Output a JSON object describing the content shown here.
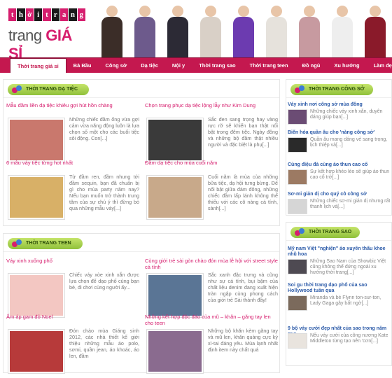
{
  "logo": {
    "top_letters": [
      "t",
      "h",
      "ờ",
      "i",
      "t",
      "r",
      "a",
      "n",
      "g"
    ],
    "bottom_plain": "trang ",
    "bottom_bold": "GIÁ SỈ"
  },
  "banner_colors": [
    "#3b2d28",
    "#6d5a8c",
    "#2c2a35",
    "#d9d0c7",
    "#6c3bb0",
    "#e6e2dc",
    "#c79aa0",
    "#eeeeee",
    "#8a1a2a"
  ],
  "nav": [
    "Thời trang giá sỉ",
    "Bà Bầu",
    "Công sở",
    "Dạ tiệc",
    "Nội y",
    "Thời trang sao",
    "Thời trang teen",
    "Đồ ngủ",
    "Xu hướng",
    "Làm đẹp"
  ],
  "sections": [
    {
      "heading": "THỜI TRANG DẠ TIỆC",
      "posts": [
        {
          "title": "Mẫu đầm liền dạ tiệc khiêu gợi hút hồn chàng",
          "excerpt": "Những chiếc đầm ống vừa gợi cảm vừa năng động luôn là lựa chọn số một cho các buổi tiệc sôi động. Con[...]",
          "thumb": "#c9786d"
        },
        {
          "title": "Chọn trang phục dạ tiệc lộng lẫy như Kim Dung",
          "excerpt": "Sắc đen sang trọng hay vàng rực rỡ sẽ khiến bạn thật nổi bật trong đêm tiệc. Ngày đông và những bộ đầm thật nhiều người và đặc biệt là phụ[...]",
          "thumb": "#3a3a3a"
        },
        {
          "title": "6 mẫu váy tiệc từng hot nhất",
          "excerpt": "Từ đầm ren, đầm nhung tới đầm sequin, bạn đã chuẩn bị gì cho mùa party năm nay? Nếu bạn muốn trở thành trung tâm của sự chú ý thì đừng bỏ qua những mẫu váy[...]",
          "thumb": "#d8b067"
        },
        {
          "title": "Đầm dạ tiệc cho mùa cuối năm",
          "excerpt": "Cuối năm là mùa của những bữa tiệc, dạ hội tưng bừng. Để nổi bật giữa đám đông, những chiếc đầm lấp lánh không thể thiếu với các cô nàng cá tính, sành[...]",
          "thumb": "#c8a98a"
        }
      ]
    },
    {
      "heading": "THỜI TRANG TEEN",
      "posts": [
        {
          "title": "Váy xinh xuống phố",
          "excerpt": "Chiếc váy xòe xinh xắn được lựa chọn để dạo phố cùng bạn bè, đi chơi cùng người ấy...",
          "thumb": "#f3c7c2"
        },
        {
          "title": "Cùng giới trẻ sài gòn chào đón mùa lễ hội với street style cá tính",
          "excerpt": "Sắc xanh đặc trưng và cũng như sự cá tính, bụi bặm của chất liệu denim đang xuất hiện tràn ngập cùng phong cách của giới trẻ Sài thành đầy!",
          "thumb": "#5a7595"
        },
        {
          "title": "Ấm áp gam đỏ Noel",
          "excerpt": "Đón chào mùa Giáng sinh 2012, các nhà thiết kế giới thiệu những mẫu áo polo, sơmi, quần jean, áo khoác, áo len, đầm",
          "thumb": "#b73a3a"
        },
        {
          "title": "Những kết hợp độc đáo của mũ – khăn – găng tay len cho teen",
          "excerpt": "Những bộ khăn kèm găng tay và mũ len, khăn quàng cực kỳ xì-tai đáng yêu. Mùa lạnh nhất định item này chất quá",
          "thumb": "#8a6b8f"
        }
      ]
    }
  ],
  "sidebar": [
    {
      "heading": "THỜI TRANG CÔNG SỞ",
      "items": [
        {
          "title": "Váy xinh nơi công sở mùa đông",
          "excerpt": "Những chiếc váy xinh xắn, duyên dáng giúp bạn[...]",
          "thumb": "#6b4c74"
        },
        {
          "title": "Biến hóa quần âu cho 'nàng công sở'",
          "excerpt": "Quần âu mang dáng vẻ sang trọng, lịch thiệp và[...]",
          "thumb": "#2a2a2a"
        },
        {
          "title": "Cùng điệu đà cùng áo thun cao cổ",
          "excerpt": "Sự kết hợp khéo léo sẽ giúp áo thun cao cổ trở[...]",
          "thumb": "#9c7a63"
        },
        {
          "title": "Sơ-mi giản dị cho quý cô công sở",
          "excerpt": "Những chiếc sơ-mi giản dị nhưng rất thanh lịch và[...]",
          "thumb": "#d6d6d6"
        }
      ]
    },
    {
      "heading": "THỜI TRANG SAO",
      "items": [
        {
          "title": "Mỹ nam Việt \"nghiện\" áo xuyên thấu khoe nhũ hoa",
          "excerpt": "Những Sao Nam của Showbiz Việt cũng không thể đứng ngoài xu hướng thời trang[...]",
          "thumb": "#4e4a52"
        },
        {
          "title": "Soi gu thời trang dạo phố của sao Hollywood tuần qua",
          "excerpt": "Miranda và bé Flynn ton-sur-ton, Lady Gaga gây bất ngờ[...]",
          "thumb": "#7b6a5c"
        },
        {
          "title": "9 bộ váy cưới đẹp nhất của sao trong năm qua",
          "excerpt": "Nếu váy cưới của công nương Kate Middleton từng tạo nên 'cơn[...]",
          "thumb": "#e9e4de"
        }
      ]
    }
  ]
}
